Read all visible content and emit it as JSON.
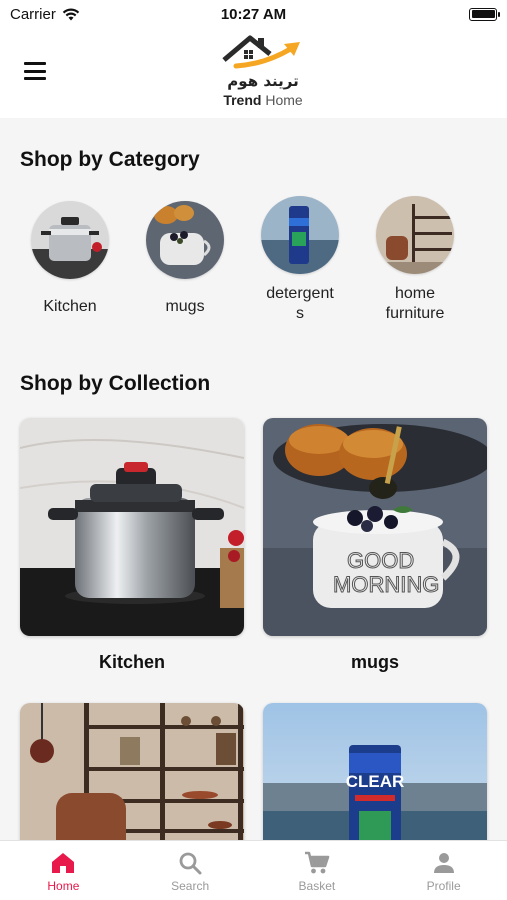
{
  "status": {
    "carrier": "Carrier",
    "time": "10:27 AM"
  },
  "header": {
    "logo_arabic": "تريند هوم",
    "logo_en_bold": "Trend",
    "logo_en_light": "Home"
  },
  "category_section": {
    "title": "Shop by Category",
    "items": [
      {
        "label": "Kitchen"
      },
      {
        "label": "mugs"
      },
      {
        "label": "detergent\ns"
      },
      {
        "label": "home\nfurniture"
      }
    ]
  },
  "collection_section": {
    "title": "Shop by Collection",
    "items": [
      {
        "label": "Kitchen"
      },
      {
        "label": "mugs"
      },
      {
        "label": ""
      },
      {
        "label": ""
      }
    ]
  },
  "mug_text": {
    "line1": "GOOD",
    "line2": "MORNING"
  },
  "product_brand": "CLEAR",
  "tabs": [
    {
      "label": "Home",
      "icon": "home-icon",
      "active": true
    },
    {
      "label": "Search",
      "icon": "search-icon",
      "active": false
    },
    {
      "label": "Basket",
      "icon": "cart-icon",
      "active": false
    },
    {
      "label": "Profile",
      "icon": "person-icon",
      "active": false
    }
  ],
  "colors": {
    "accent": "#e8194b",
    "logo_orange": "#f5a623",
    "inactive": "#9a9a9a"
  }
}
